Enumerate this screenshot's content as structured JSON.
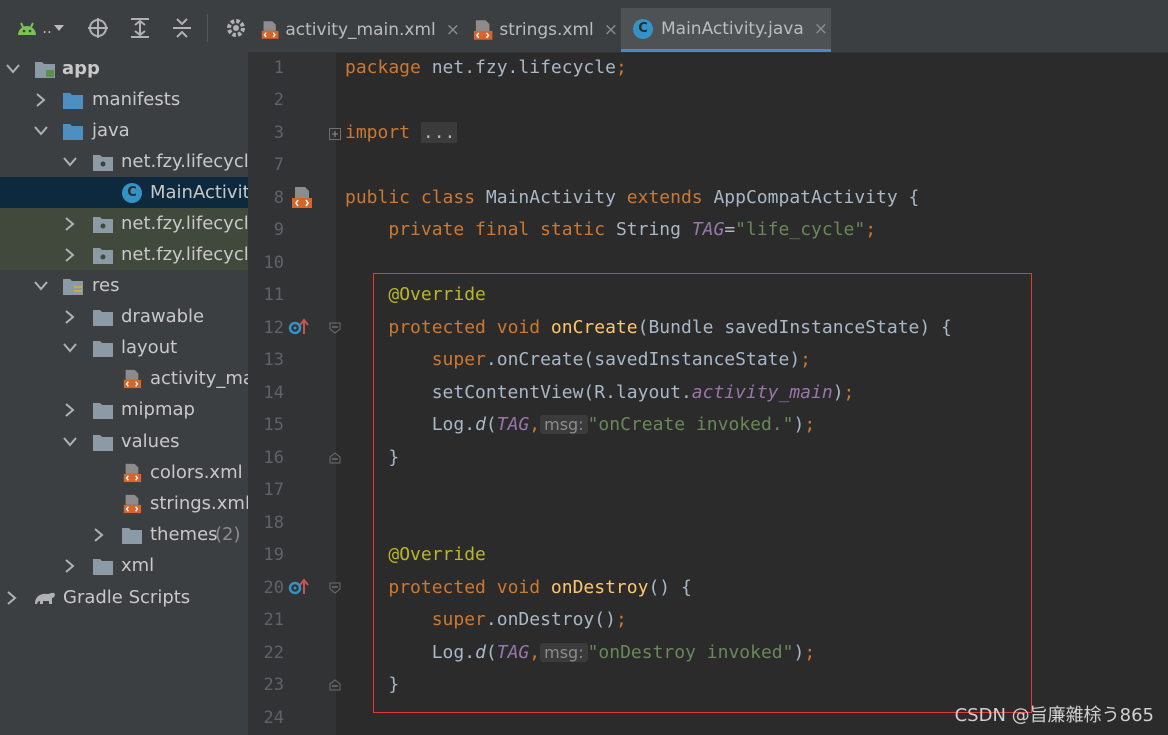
{
  "toolbar": {
    "android_label": "..",
    "buttons": [
      "android-icon",
      "locate-icon",
      "expand-all-icon",
      "collapse-all-icon",
      "gear-icon"
    ]
  },
  "tabs": [
    {
      "label": "activity_main.xml",
      "icon": "xml-file-icon",
      "active": false
    },
    {
      "label": "strings.xml",
      "icon": "xml-file-icon",
      "active": false
    },
    {
      "label": "MainActivity.java",
      "icon": "java-class-icon",
      "active": true
    }
  ],
  "tab_close": "×",
  "class_icon_letter": "C",
  "tree": {
    "app": "app",
    "manifests": "manifests",
    "java": "java",
    "pkg1": "net.fzy.lifecycle",
    "main_activity": "MainActivity",
    "pkg2": "net.fzy.lifecycle",
    "pkg3": "net.fzy.lifecycle",
    "res": "res",
    "drawable": "drawable",
    "layout": "layout",
    "activity_main": "activity_main",
    "mipmap": "mipmap",
    "values": "values",
    "colors": "colors.xml",
    "strings": "strings.xml",
    "themes": "themes",
    "themes_count": "(2)",
    "xml": "xml",
    "gradle": "Gradle Scripts"
  },
  "line_numbers": [
    "1",
    "2",
    "3",
    "7",
    "8",
    "9",
    "10",
    "11",
    "12",
    "13",
    "14",
    "15",
    "16",
    "17",
    "18",
    "19",
    "20",
    "21",
    "22",
    "23",
    "24"
  ],
  "code": {
    "l1_kw": "package",
    "l1_rest": " net.fzy.lifecycle",
    "l1_semi": ";",
    "l3_kw": "import",
    "l3_fold": "...",
    "l8_kw": "public class",
    "l8_name": " MainActivity ",
    "l8_kw2": "extends",
    "l8_rest": " AppCompatActivity {",
    "l9_kw": "private final static",
    "l9_type": " String ",
    "l9_field": "TAG",
    "l9_eq": "=",
    "l9_str": "\"life_cycle\"",
    "l9_semi": ";",
    "override": "@Override",
    "protected_void": "protected void",
    "oncreate_name": " onCreate",
    "oncreate_params": "(Bundle savedInstanceState) {",
    "super": "super",
    "oncreate_call": ".onCreate(savedInstanceState)",
    "semi": ";",
    "setcontent_a": "setContentView(R.layout.",
    "setcontent_field": "activity_main",
    "setcontent_b": ")",
    "log_a": "Log.",
    "log_d": "d",
    "log_paren": "(",
    "log_tag": "TAG",
    "comma": ",",
    "msg_hint": "msg:",
    "oncreate_str": "\"onCreate invoked.\"",
    "close_paren": ")",
    "brace_close": "}",
    "ondestroy_name": " onDestroy",
    "ondestroy_params": "() {",
    "ondestroy_call": ".onDestroy()",
    "ondestroy_str": "\"onDestroy invoked\""
  },
  "watermark": "CSDN @旨廉雜梌う865",
  "colors": {
    "keyword": "#cc7832",
    "string": "#6a8759",
    "annotation": "#bbb529",
    "field": "#9876aa",
    "method": "#ffc66d",
    "highlight_box": "#e53935"
  }
}
